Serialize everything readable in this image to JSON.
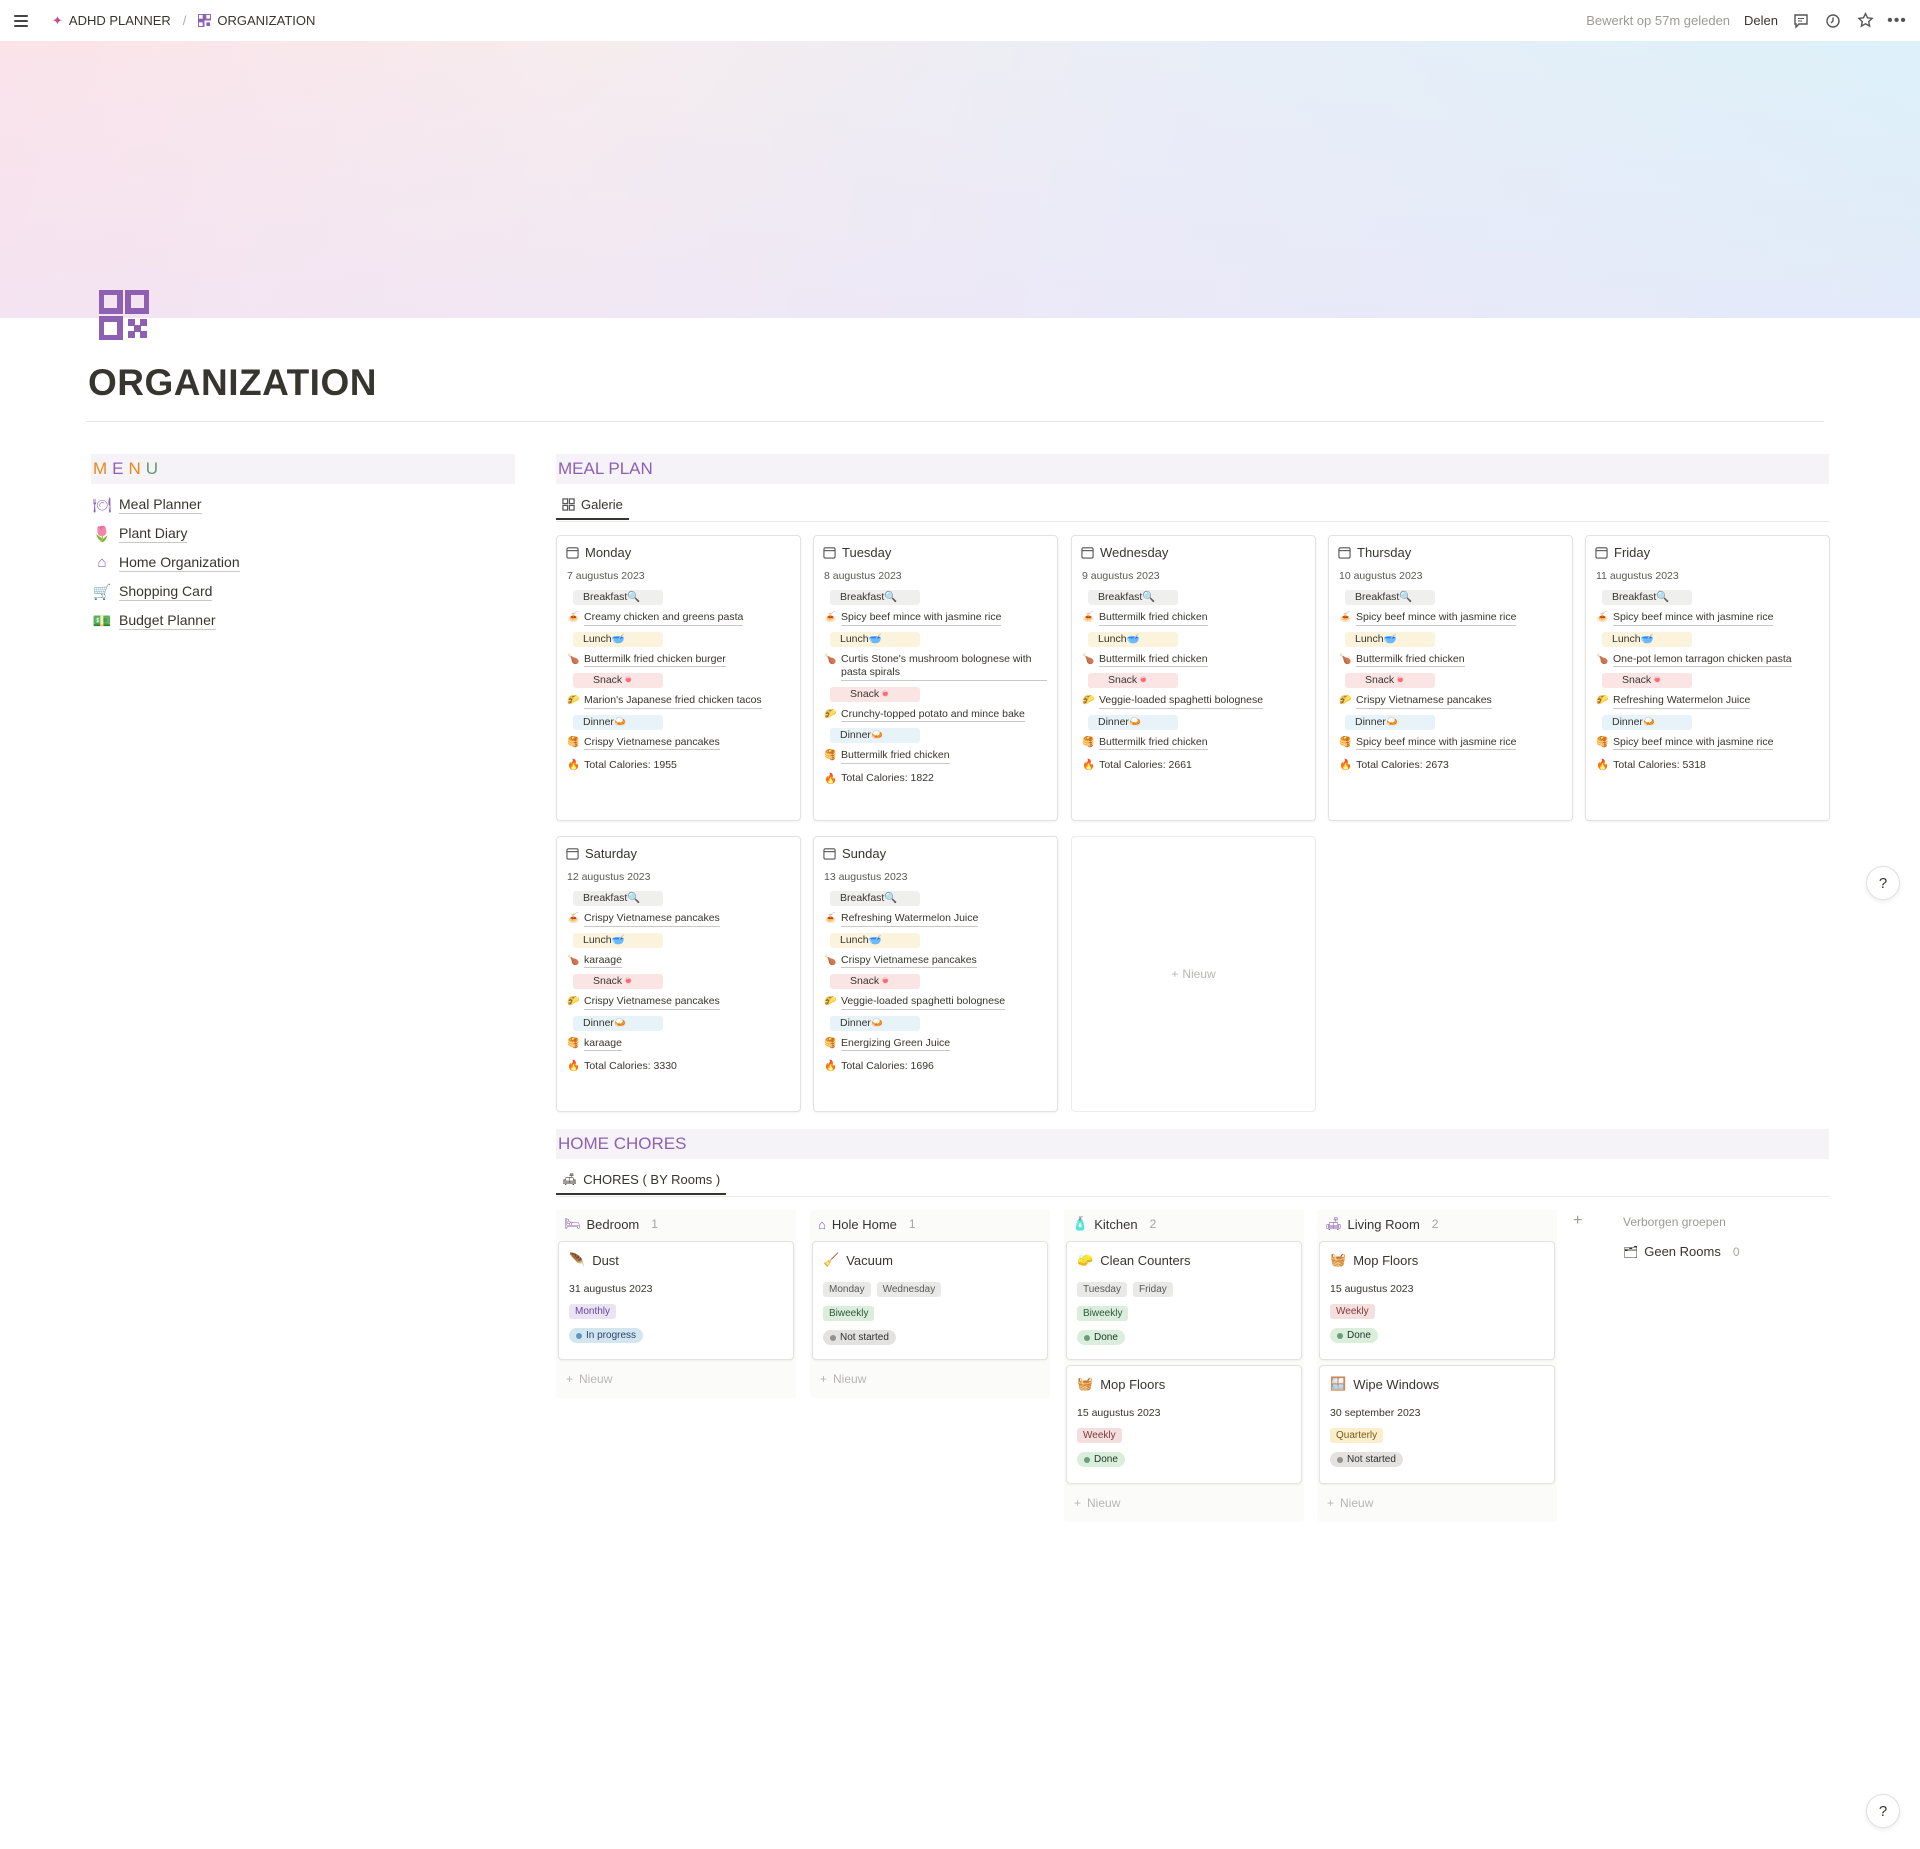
{
  "breadcrumb": {
    "workspace": "ADHD PLANNER",
    "page": "ORGANIZATION"
  },
  "topbar": {
    "edited": "Bewerkt op 57m geleden",
    "share": "Delen"
  },
  "page": {
    "title": "ORGANIZATION"
  },
  "menu": {
    "header_letters": [
      {
        "ch": "M",
        "color": "#e8891b"
      },
      {
        "ch": "E",
        "color": "#8e60b2"
      },
      {
        "ch": "N",
        "color": "#e8891b"
      },
      {
        "ch": "U",
        "color": "#5b9e6e"
      }
    ],
    "items": [
      {
        "label": "Meal Planner",
        "icon": "plate-icon"
      },
      {
        "label": "Plant Diary",
        "icon": "tulip-icon"
      },
      {
        "label": "Home Organization",
        "icon": "house-icon"
      },
      {
        "label": "Shopping Card",
        "icon": "cart-icon"
      },
      {
        "label": "Budget Planner",
        "icon": "money-icon"
      }
    ]
  },
  "meal_plan": {
    "title": "MEAL PLAN",
    "view": "Galerie",
    "tags": {
      "breakfast": "Breakfast🔍",
      "lunch": "Lunch🥣",
      "snack": "Snack🍬",
      "dinner": "Dinner🍛"
    },
    "new_label": "Nieuw",
    "days": [
      {
        "day": "Monday",
        "date": "7 augustus 2023",
        "breakfast": "Creamy chicken and greens pasta",
        "lunch": "Buttermilk fried chicken burger",
        "snack": "Marion's Japanese fried chicken tacos",
        "dinner": "Crispy Vietnamese pancakes",
        "calories": "Total Calories: 1955"
      },
      {
        "day": "Tuesday",
        "date": "8 augustus 2023",
        "breakfast": "Spicy beef mince with jasmine rice",
        "lunch": "Curtis Stone's mushroom bolognese with pasta spirals",
        "snack": "Crunchy-topped potato and mince bake",
        "dinner": "Buttermilk fried chicken",
        "calories": "Total Calories: 1822"
      },
      {
        "day": "Wednesday",
        "date": "9 augustus 2023",
        "breakfast": "Buttermilk fried chicken",
        "lunch": "Buttermilk fried chicken",
        "snack": "Veggie-loaded spaghetti bolognese",
        "dinner": "Buttermilk fried chicken",
        "calories": "Total Calories: 2661"
      },
      {
        "day": "Thursday",
        "date": "10 augustus 2023",
        "breakfast": "Spicy beef mince with jasmine rice",
        "lunch": "Buttermilk fried chicken",
        "snack": "Crispy Vietnamese pancakes",
        "dinner": "Spicy beef mince with jasmine rice",
        "calories": "Total Calories: 2673"
      },
      {
        "day": "Friday",
        "date": "11 augustus 2023",
        "breakfast": "Spicy beef mince with jasmine rice",
        "lunch": "One-pot lemon tarragon chicken pasta",
        "snack": "Refreshing Watermelon Juice",
        "dinner": "Spicy beef mince with jasmine rice",
        "calories": "Total Calories: 5318"
      },
      {
        "day": "Saturday",
        "date": "12 augustus 2023",
        "breakfast": "Crispy Vietnamese pancakes",
        "lunch": "karaage",
        "snack": "Crispy Vietnamese pancakes",
        "dinner": "karaage",
        "calories": "Total Calories: 3330"
      },
      {
        "day": "Sunday",
        "date": "13 augustus 2023",
        "breakfast": "Refreshing Watermelon Juice",
        "lunch": "Crispy Vietnamese pancakes",
        "snack": "Veggie-loaded spaghetti bolognese",
        "dinner": "Energizing Green Juice",
        "calories": "Total Calories: 1696"
      }
    ]
  },
  "chores": {
    "title": "HOME CHORES",
    "view": "CHORES ( BY Rooms )",
    "new_label": "Nieuw",
    "hidden_groups": "Verborgen groepen",
    "hidden_item": {
      "label": "Geen Rooms",
      "count": "0"
    },
    "columns": [
      {
        "name": "Bedroom",
        "count": "1",
        "icon": "bed-icon",
        "cards": [
          {
            "title": "Dust",
            "icon": "duster-icon",
            "date": "31 augustus 2023",
            "days": [],
            "freq": "Monthly",
            "status": "In progress"
          }
        ]
      },
      {
        "name": "Hole Home",
        "count": "1",
        "icon": "house-icon",
        "cards": [
          {
            "title": "Vacuum",
            "icon": "vacuum-icon",
            "date": "",
            "days": [
              "Monday",
              "Wednesday"
            ],
            "freq": "Biweekly",
            "status": "Not started"
          }
        ]
      },
      {
        "name": "Kitchen",
        "count": "2",
        "icon": "bottle-icon",
        "cards": [
          {
            "title": "Clean Counters",
            "icon": "spray-icon",
            "date": "",
            "days": [
              "Tuesday",
              "Friday"
            ],
            "freq": "Biweekly",
            "status": "Done"
          },
          {
            "title": "Mop Floors",
            "icon": "mop-icon",
            "date": "15 augustus 2023",
            "days": [],
            "freq": "Weekly",
            "status": "Done"
          }
        ]
      },
      {
        "name": "Living Room",
        "count": "2",
        "icon": "sofa-icon",
        "cards": [
          {
            "title": "Mop Floors",
            "icon": "mop-icon",
            "date": "15 augustus 2023",
            "days": [],
            "freq": "Weekly",
            "status": "Done"
          },
          {
            "title": "Wipe Windows",
            "icon": "window-icon",
            "date": "30 september 2023",
            "days": [],
            "freq": "Quarterly",
            "status": "Not started"
          }
        ]
      }
    ]
  },
  "colors": {
    "accent": "#8e60b2",
    "text": "#37352f",
    "muted": "#9b9a97"
  }
}
